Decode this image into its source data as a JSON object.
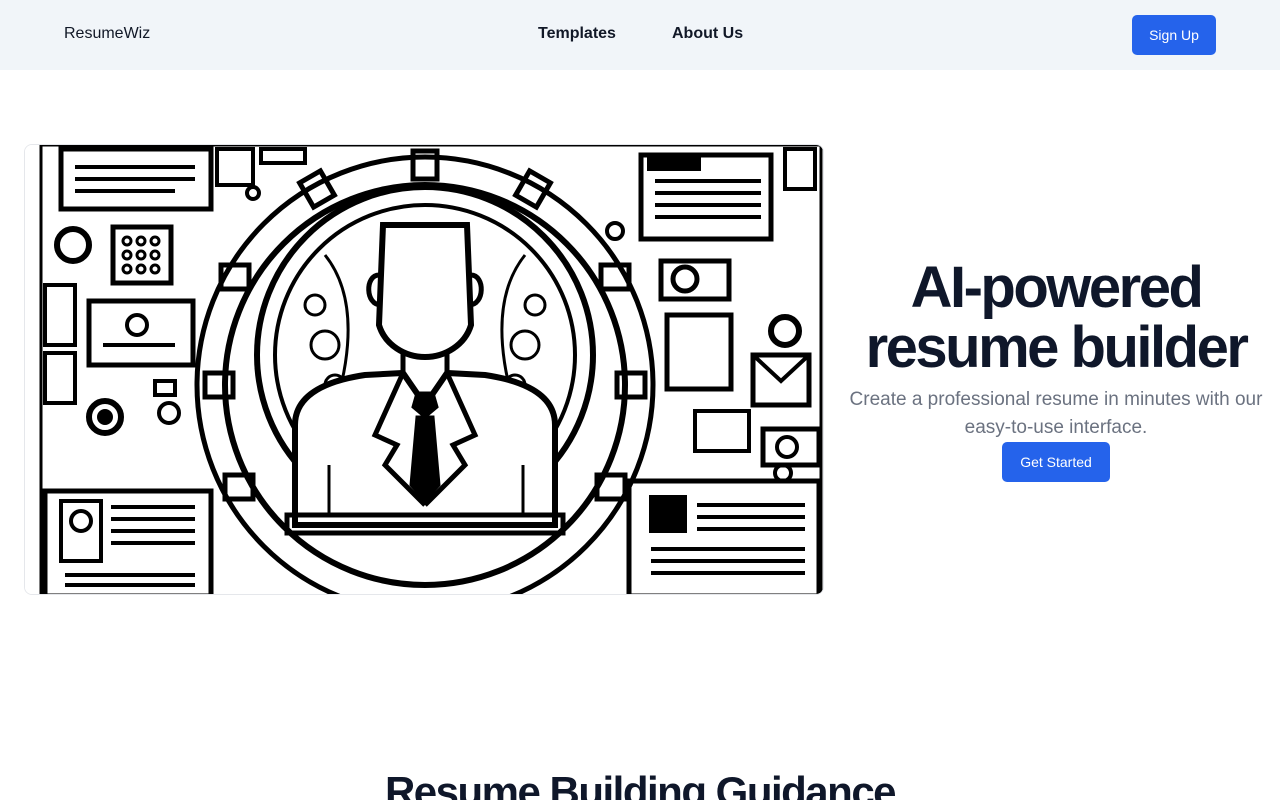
{
  "nav": {
    "brand": "ResumeWiz",
    "links": [
      "Templates",
      "About Us"
    ],
    "signup_label": "Sign Up"
  },
  "hero": {
    "title": "AI-powered resume builder",
    "subtitle": "Create a professional resume in minutes with our easy-to-use interface.",
    "cta_label": "Get Started",
    "image_icon": "businessman-gears-illustration"
  },
  "sections": {
    "guidance_heading": "Resume Building Guidance"
  },
  "colors": {
    "accent": "#2563eb",
    "nav_background": "#f1f5f9",
    "text_dark": "#0f172a",
    "text_muted": "#6b7280"
  }
}
